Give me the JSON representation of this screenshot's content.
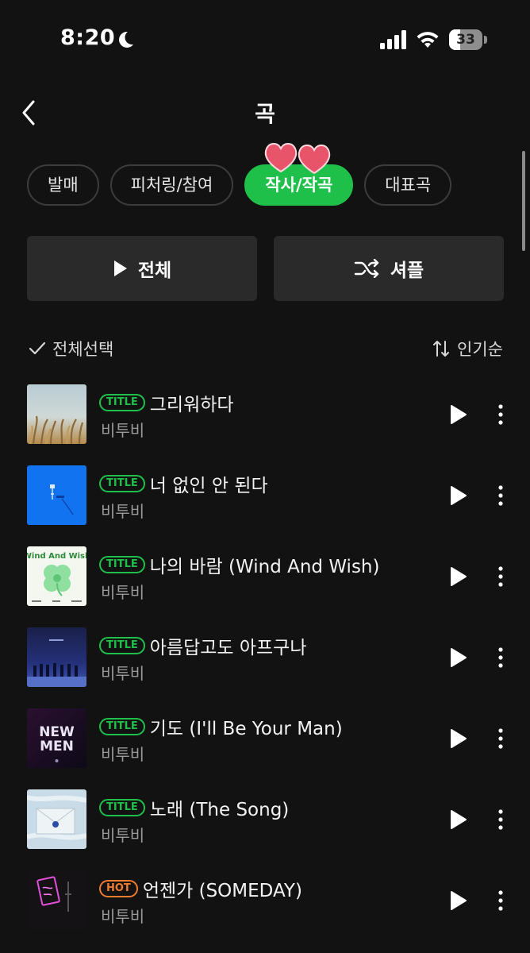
{
  "status_bar": {
    "time": "8:20",
    "battery_level": "33",
    "battery_fraction": 0.33
  },
  "header": {
    "title": "곡"
  },
  "filters": [
    {
      "label": "발매",
      "active": false
    },
    {
      "label": "피처링/참여",
      "active": false
    },
    {
      "label": "작사/작곡",
      "active": true
    },
    {
      "label": "대표곡",
      "active": false
    }
  ],
  "actions": {
    "play_all": "전체",
    "shuffle": "셔플"
  },
  "list_controls": {
    "select_all": "전체선택",
    "sort": "인기순"
  },
  "songs": [
    {
      "badge": "TITLE",
      "title": "그리워하다",
      "artist": "비투비",
      "cover": "wheat-field"
    },
    {
      "badge": "TITLE",
      "title": "너 없인 안 된다",
      "artist": "비투비",
      "cover": "blue-balloon"
    },
    {
      "badge": "TITLE",
      "title": "나의 바람 (Wind And Wish)",
      "artist": "비투비",
      "cover": "green-clover",
      "cover_text": "Wind And Wish"
    },
    {
      "badge": "TITLE",
      "title": "아름답고도 아프구나",
      "artist": "비투비",
      "cover": "night-sky-group"
    },
    {
      "badge": "TITLE",
      "title": "기도 (I'll Be Your Man)",
      "artist": "비투비",
      "cover": "new-men",
      "cover_text": [
        "NEW",
        "MEN"
      ]
    },
    {
      "badge": "TITLE",
      "title": "노래 (The Song)",
      "artist": "비투비",
      "cover": "envelope"
    },
    {
      "badge": "HOT",
      "title": "언젠가 (SOMEDAY)",
      "artist": "비투비",
      "cover": "neon-sign"
    }
  ],
  "colors": {
    "accent": "#1fc04a",
    "hot": "#f07a2d",
    "background": "#121212",
    "button": "#2a2a2a"
  }
}
